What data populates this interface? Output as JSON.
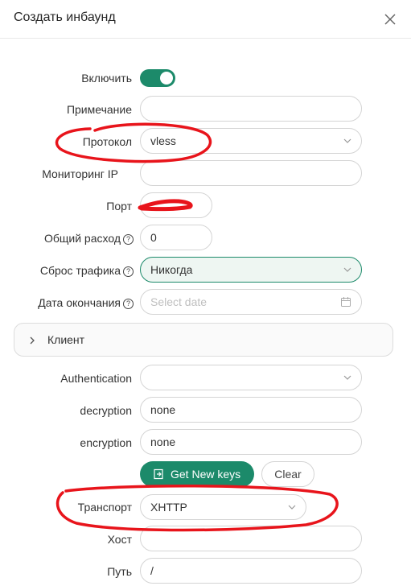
{
  "modal": {
    "title": "Создать инбаунд"
  },
  "form": {
    "enable": {
      "label": "Включить",
      "on": true
    },
    "remark": {
      "label": "Примечание",
      "value": ""
    },
    "protocol": {
      "label": "Протокол",
      "value": "vless"
    },
    "monitor_ip": {
      "label": "Мониторинг IP",
      "value": ""
    },
    "port": {
      "label": "Порт",
      "value": ""
    },
    "total_traffic": {
      "label": "Общий расход",
      "value": "0"
    },
    "traffic_reset": {
      "label": "Сброс трафика",
      "value": "Никогда"
    },
    "expiry": {
      "label": "Дата окончания",
      "placeholder": "Select date"
    },
    "client_section": {
      "label": "Клиент"
    },
    "authentication": {
      "label": "Authentication",
      "value": ""
    },
    "decryption": {
      "label": "decryption",
      "value": "none"
    },
    "encryption": {
      "label": "encryption",
      "value": "none"
    },
    "get_keys_button": "Get New keys",
    "clear_button": "Clear",
    "transport": {
      "label": "Транспорт",
      "value": "XHTTP"
    },
    "host": {
      "label": "Хост",
      "value": ""
    },
    "path": {
      "label": "Путь",
      "value": "/"
    }
  },
  "help_glyph": "?",
  "colors": {
    "accent": "#1c8a6a",
    "annotation": "#e8141b"
  },
  "icons": [
    "close-icon",
    "chevron-down-icon",
    "calendar-icon",
    "chevron-right-icon",
    "key-icon",
    "help-icon"
  ]
}
